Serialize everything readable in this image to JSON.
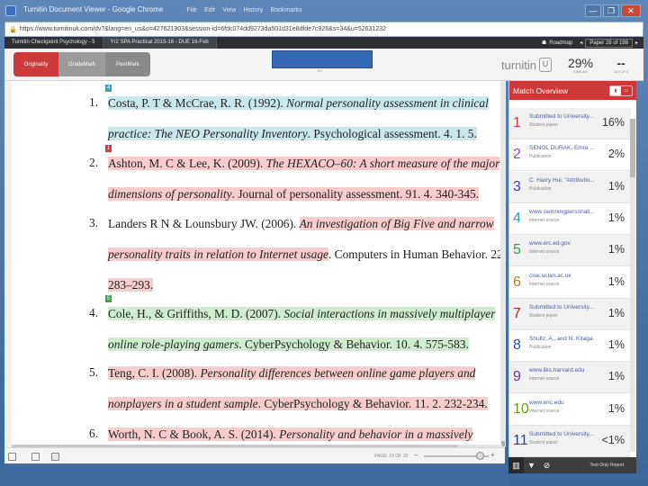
{
  "window": {
    "title": "Turnitin Document Viewer - Google Chrome",
    "menu": [
      "File",
      "Edit",
      "View",
      "History",
      "Bookmarks"
    ],
    "buttons": [
      "—",
      "❐",
      "✕"
    ]
  },
  "address": {
    "url": "https://www.turnitinuk.com/dv?&lang=en_us&o=427621903&session-id=6fdc074dd9273da501d31e8dfde7c926&s=34&u=52631232"
  },
  "tabs": [
    "Turnitin Checkpoint Psychology - 5",
    "Yr2 SPA Practical 2015-16 - DUE 16-Feb"
  ],
  "topbar": {
    "roadmap_label": "Roadmap",
    "page_label": "Paper 28 of 198"
  },
  "modes": [
    {
      "label": "Originality"
    },
    {
      "label": "GradeMark"
    },
    {
      "label": "PeerMark"
    }
  ],
  "header": {
    "by_label": "BY",
    "brand": "turnitin",
    "brand_mark": "U",
    "similarity_value": "29%",
    "similarity_label": "SIMILAR",
    "outof_value": "--",
    "outof_label": "OUT OF 0"
  },
  "references": [
    {
      "num": "1.",
      "marker": "4",
      "lines": [
        [
          {
            "t": "Costa, P. T & McCrae, R. R. (1992). ",
            "it": false
          },
          {
            "t": "Normal personality assessment in clinical",
            "it": true
          }
        ],
        [
          {
            "t": "practice: The NEO Personality Inventory",
            "it": true
          },
          {
            "t": ". Psychological assessment. 4. 1. 5.",
            "it": false
          }
        ]
      ]
    },
    {
      "num": "2.",
      "marker": "1",
      "lines": [
        [
          {
            "t": "Ashton, M. C & Lee, K. (2009). ",
            "it": false
          },
          {
            "t": "The HEXACO–60: A short measure of the major",
            "it": true
          }
        ],
        [
          {
            "t": "dimensions of personality",
            "it": true
          },
          {
            "t": ". Journal of personality assessment. 91. 4. 340-345.",
            "it": false
          }
        ]
      ]
    },
    {
      "num": "3.",
      "marker": "",
      "lines": [
        [
          {
            "t": "Landers R N & Lounsbury JW. (2006). ",
            "it": false
          },
          {
            "t": "An investigation of Big Five and narrow",
            "it": true
          }
        ],
        [
          {
            "t": "personality traits in relation to Internet usage",
            "it": true
          },
          {
            "t": ". Computers in Human Behavior. 22.",
            "it": false
          }
        ],
        [
          {
            "t": "283–293.",
            "it": false
          }
        ]
      ]
    },
    {
      "num": "4.",
      "marker": "5",
      "lines": [
        [
          {
            "t": "Cole, H., & Griffiths, M. D. (2007). ",
            "it": false
          },
          {
            "t": "Social interactions in massively multiplayer",
            "it": true
          }
        ],
        [
          {
            "t": "online role-playing gamers",
            "it": true
          },
          {
            "t": ". CyberPsychology & Behavior. 10. 4. 575-583.",
            "it": false
          }
        ]
      ]
    },
    {
      "num": "5.",
      "marker": "",
      "lines": [
        [
          {
            "t": "Teng, C. I. (2008). ",
            "it": false
          },
          {
            "t": "Personality differences between online game players and",
            "it": true
          }
        ],
        [
          {
            "t": "nonplayers in a student sample",
            "it": true
          },
          {
            "t": ". CyberPsychology & Behavior. 11. 2. 232-234.",
            "it": false
          }
        ]
      ]
    },
    {
      "num": "6.",
      "marker": "",
      "lines": [
        [
          {
            "t": "Worth, N. C & Book, A. S. (2014). ",
            "it": false
          },
          {
            "t": "Personality and behavior in a massively",
            "it": true
          }
        ]
      ]
    }
  ],
  "statusbar": {
    "page_info": "PAGE: 10 OF 10",
    "zoom_minus": "–",
    "zoom_plus": "+"
  },
  "panel": {
    "title": "Match Overview",
    "toggle": [
      "▮",
      "▭"
    ],
    "footer_link": "Text-Only Report",
    "footer_icons": [
      "bars-icon",
      "filter-icon",
      "exclude-icon"
    ]
  },
  "matches": [
    {
      "n": "1",
      "src": "Submitted to University...",
      "type": "Student paper",
      "pct": "16%",
      "color": "#d0393b"
    },
    {
      "n": "2",
      "src": "SENOL DURAK, Emre ...",
      "type": "Publication",
      "pct": "2%",
      "color": "#a33ab3"
    },
    {
      "n": "3",
      "src": "C. Harry Hui. \"Attributio...",
      "type": "Publication",
      "pct": "1%",
      "color": "#3b3fae"
    },
    {
      "n": "4",
      "src": "www.swinningpersonali...",
      "type": "Internet source",
      "pct": "1%",
      "color": "#2c9fb8"
    },
    {
      "n": "5",
      "src": "www.erc.ed.gov",
      "type": "Internet source",
      "pct": "1%",
      "color": "#2fa33b"
    },
    {
      "n": "6",
      "src": "cloe.uclan.ac.uk",
      "type": "Internet source",
      "pct": "1%",
      "color": "#c07a12"
    },
    {
      "n": "7",
      "src": "Submitted to University...",
      "type": "Student paper",
      "pct": "1%",
      "color": "#9b2a2a"
    },
    {
      "n": "8",
      "src": "Shultz, A., and N. Kitaga.",
      "type": "Publication",
      "pct": "1%",
      "color": "#1f4f9e"
    },
    {
      "n": "9",
      "src": "www.liks.harvard.edu",
      "type": "Internet source",
      "pct": "1%",
      "color": "#6b2fa6"
    },
    {
      "n": "10",
      "src": "www.eric.edu",
      "type": "Internet source",
      "pct": "1%",
      "color": "#6b9b1f"
    },
    {
      "n": "11",
      "src": "Submitted to University...",
      "type": "Student paper",
      "pct": "<1%",
      "color": "#2a3f9b"
    }
  ]
}
